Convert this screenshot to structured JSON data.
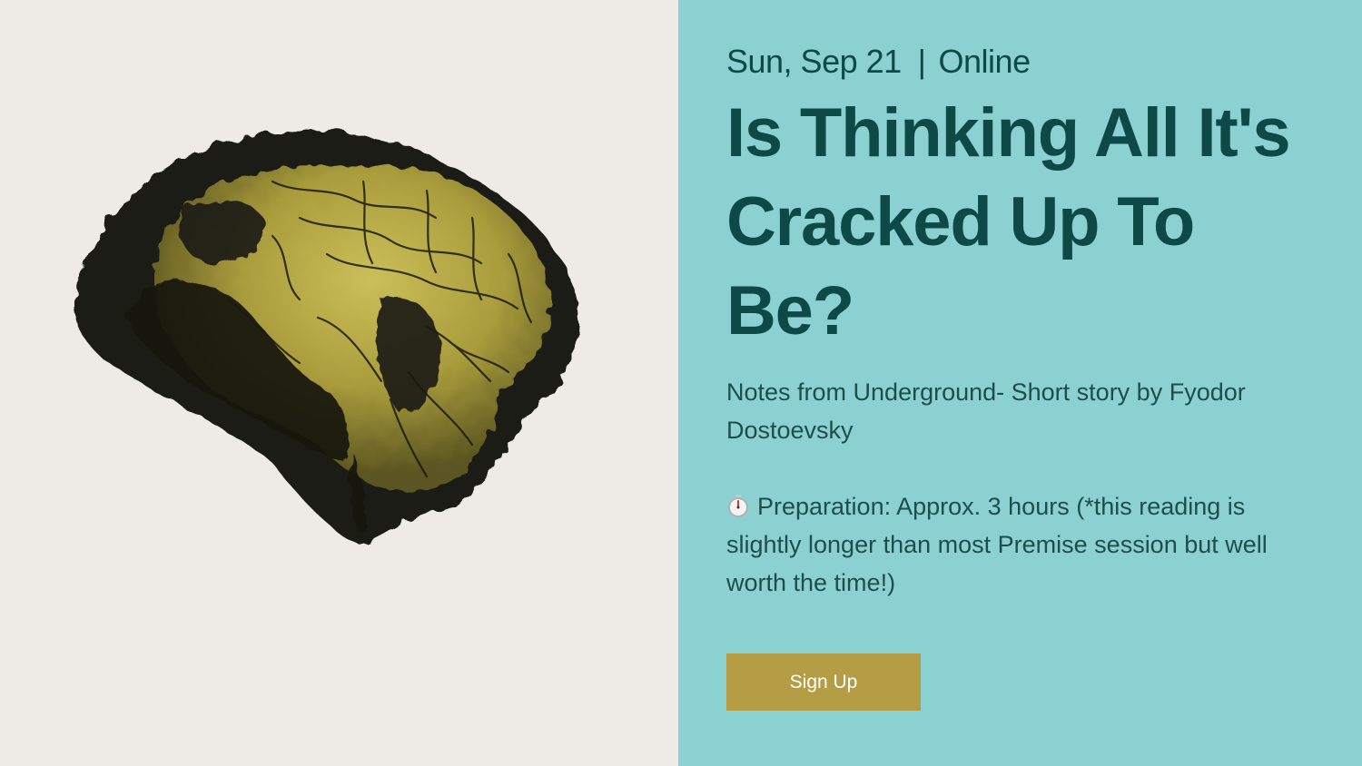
{
  "event": {
    "date": "Sun, Sep 21",
    "separator": "|",
    "location": "Online",
    "title": "Is Thinking All It's Cracked Up To Be?",
    "subtitle": "Notes from Underground- Short story by Fyodor Dostoevsky",
    "prep_icon": "stopwatch-icon",
    "preparation": "Preparation: Approx. 3 hours (*this reading is slightly longer than most Premise session but well worth the time!)",
    "signup_label": "Sign Up"
  },
  "artwork": {
    "subject": "brain-illustration"
  },
  "colors": {
    "left_bg": "#eeebe7",
    "right_bg": "#8bd1d1",
    "heading": "#0d4a47",
    "body_text": "#1d4e4c",
    "button_bg": "#b59d45",
    "button_text": "#ffffff",
    "brain_ink": "#1a1a12",
    "brain_yellow": "#b9ac45"
  }
}
